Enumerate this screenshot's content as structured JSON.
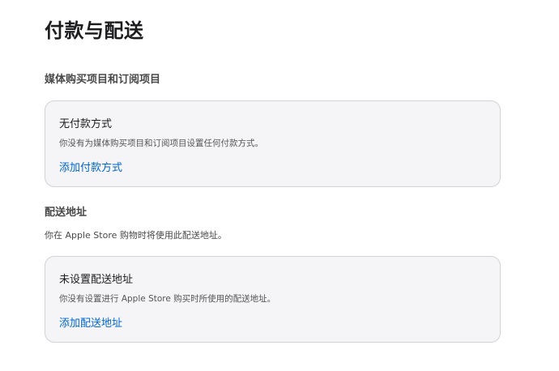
{
  "page": {
    "title": "付款与配送"
  },
  "payment": {
    "section_title": "媒体购买项目和订阅项目",
    "card": {
      "title": "无付款方式",
      "description": "你没有为媒体购买项目和订阅项目设置任何付款方式。",
      "link_label": "添加付款方式"
    }
  },
  "shipping": {
    "section_title": "配送地址",
    "description": "你在 Apple Store 购物时将使用此配送地址。",
    "card": {
      "title": "未设置配送地址",
      "description": "你没有设置进行 Apple Store 购买时所使用的配送地址。",
      "link_label": "添加配送地址"
    }
  },
  "colors": {
    "link": "#0066cc",
    "card_background": "#f5f5f7",
    "card_border": "#d2d2d7",
    "text_primary": "#1d1d1f",
    "text_secondary": "#494949"
  }
}
